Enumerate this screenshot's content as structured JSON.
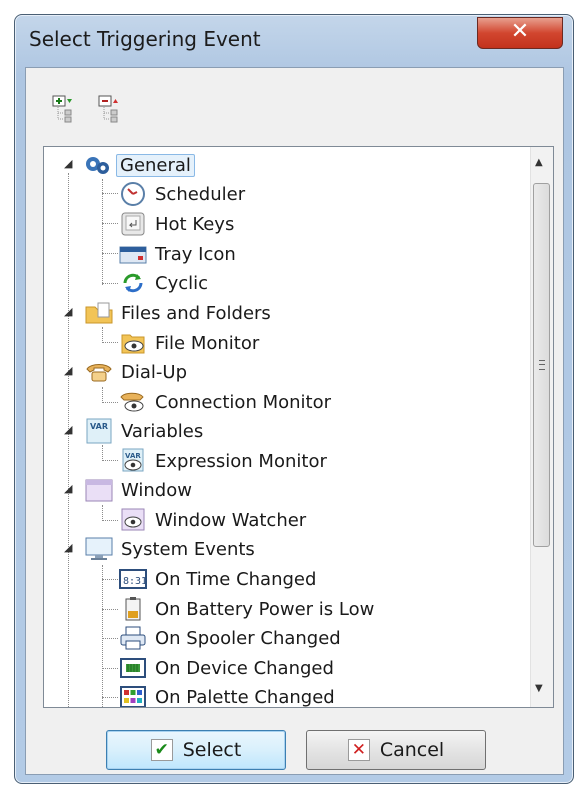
{
  "window": {
    "title": "Select Triggering Event",
    "close_label": "✕"
  },
  "toolbar": {
    "expand_icon": "expand-all-icon",
    "collapse_icon": "collapse-all-icon"
  },
  "tree": {
    "general": {
      "label": "General",
      "children": [
        "Scheduler",
        "Hot Keys",
        "Tray Icon",
        "Cyclic"
      ]
    },
    "files": {
      "label": "Files and Folders",
      "children": [
        "File Monitor"
      ]
    },
    "dialup": {
      "label": "Dial-Up",
      "children": [
        "Connection Monitor"
      ]
    },
    "variables": {
      "label": "Variables",
      "children": [
        "Expression Monitor"
      ]
    },
    "window": {
      "label": "Window",
      "children": [
        "Window Watcher"
      ]
    },
    "system": {
      "label": "System Events",
      "children": [
        "On Time Changed",
        "On Battery Power is Low",
        "On Spooler Changed",
        "On Device Changed",
        "On Palette Changed"
      ]
    }
  },
  "buttons": {
    "select": "Select",
    "cancel": "Cancel"
  },
  "colors": {
    "selection": "#e5f1fb",
    "accent": "#3c7fb1",
    "close": "#c2321c"
  }
}
